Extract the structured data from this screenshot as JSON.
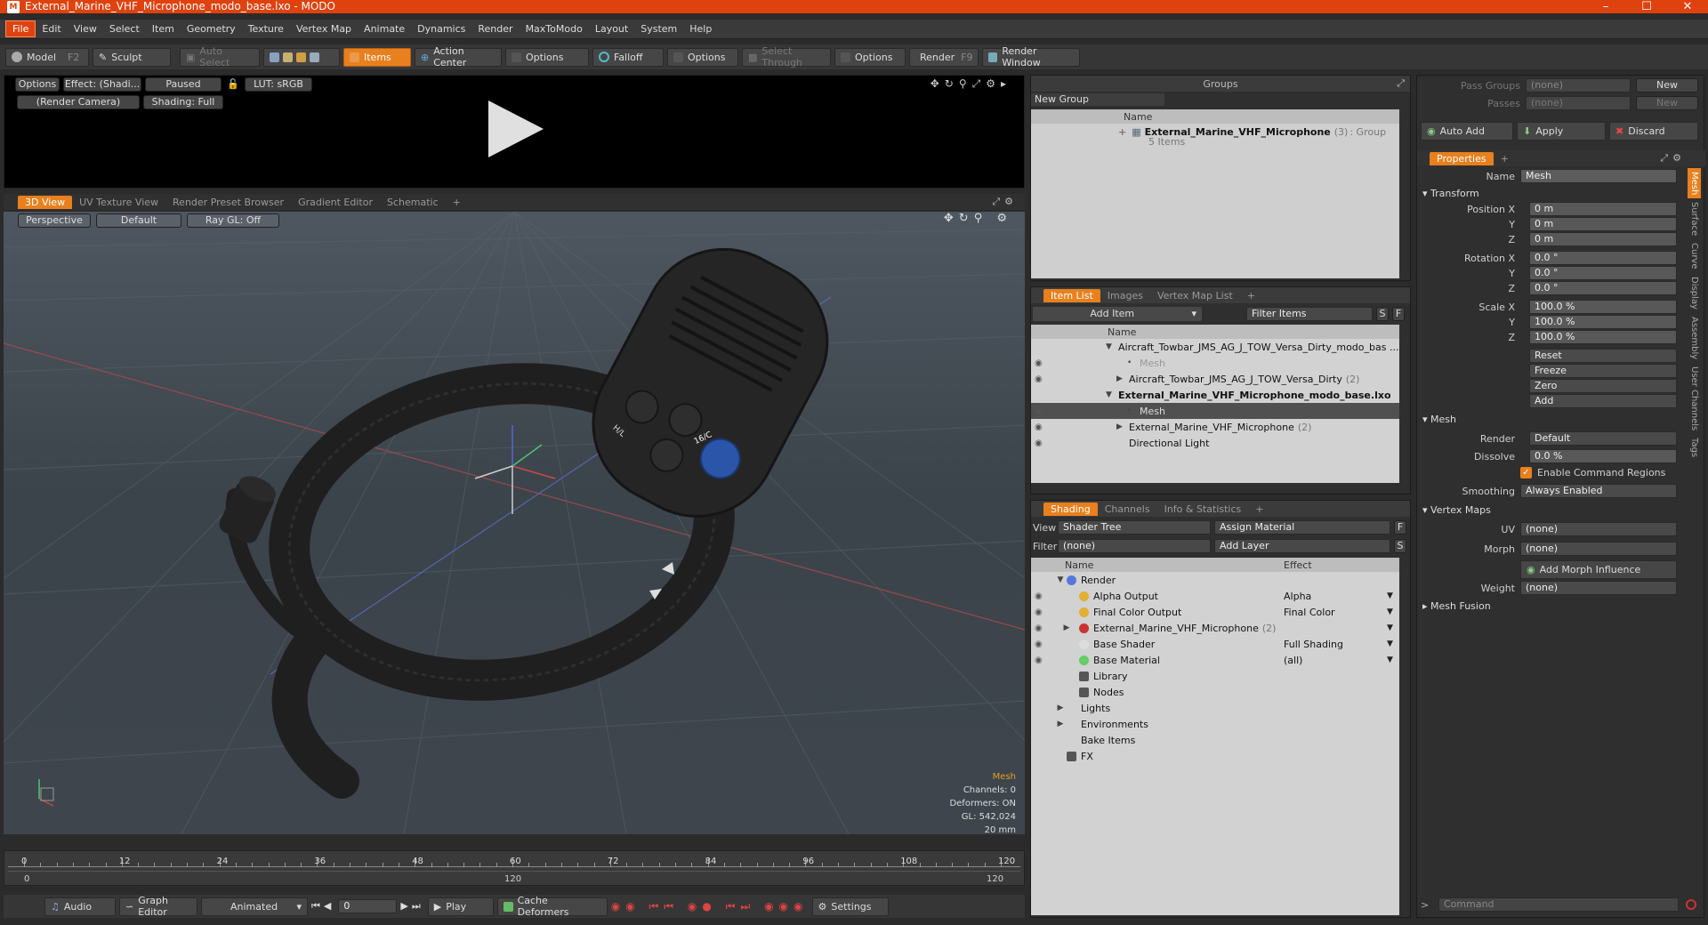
{
  "title": "External_Marine_VHF_Microphone_modo_base.lxo - MODO",
  "logo": "M",
  "menu": [
    "File",
    "Edit",
    "View",
    "Select",
    "Item",
    "Geometry",
    "Texture",
    "Vertex Map",
    "Animate",
    "Dynamics",
    "Render",
    "MaxToModo",
    "Layout",
    "System",
    "Help"
  ],
  "toolbar": {
    "model": "Model",
    "model_key": "F2",
    "sculpt": "Sculpt",
    "auto_select": "Auto Select",
    "items": "Items",
    "action_center": "Action Center",
    "options1": "Options",
    "falloff": "Falloff",
    "options2": "Options",
    "select_through": "Select Through",
    "options3": "Options",
    "render": "Render",
    "render_key": "F9",
    "render_window": "Render Window"
  },
  "preview": {
    "options": "Options",
    "effect": "Effect: (Shadi...",
    "paused": "Paused",
    "lut": "LUT: sRGB",
    "camera": "(Render Camera)",
    "shading": "Shading: Full"
  },
  "viewtabs": [
    "3D View",
    "UV Texture View",
    "Render Preset Browser",
    "Gradient Editor",
    "Schematic"
  ],
  "viewport": {
    "projection": "Perspective",
    "style": "Default",
    "raygl": "Ray GL: Off"
  },
  "stats": {
    "type": "Mesh",
    "channels": "Channels: 0",
    "deformers": "Deformers: ON",
    "gl": "GL: 542,024",
    "units": "20 mm"
  },
  "mic_labels": {
    "hl": "H/L",
    "ch": "16/C"
  },
  "timeline": {
    "ticks": [
      "0",
      "12",
      "24",
      "36",
      "48",
      "60",
      "72",
      "84",
      "96",
      "108",
      "120"
    ],
    "start": "0",
    "mid": "120",
    "end": "120"
  },
  "bottom": {
    "audio": "Audio",
    "graph_editor": "Graph Editor",
    "animated": "Animated",
    "frame": "0",
    "play": "Play",
    "cache": "Cache Deformers",
    "settings": "Settings"
  },
  "groups": {
    "title": "Groups",
    "new_group": "New Group",
    "col_name": "Name",
    "item_name": "External_Marine_VHF_Microphone",
    "item_count": "(3)",
    "item_type": ": Group",
    "item_sub": "5 Items"
  },
  "itemlist": {
    "tabs": [
      "Item List",
      "Images",
      "Vertex Map List"
    ],
    "add_item": "Add Item",
    "filter": "Filter Items",
    "s": "S",
    "f": "F",
    "col_name": "Name",
    "rows": [
      {
        "label": "Aircraft_Towbar_JMS_AG_J_TOW_Versa_Dirty_modo_bas ...",
        "indent": 0,
        "bold": false
      },
      {
        "label": "Mesh",
        "indent": 2,
        "bold": false,
        "dim": true
      },
      {
        "label": "Aircraft_Towbar_JMS_AG_J_TOW_Versa_Dirty",
        "count": "(2)",
        "indent": 1,
        "bold": false
      },
      {
        "label": "External_Marine_VHF_Microphone_modo_base.lxo",
        "indent": 0,
        "bold": true
      },
      {
        "label": "Mesh",
        "indent": 2,
        "bold": false,
        "dim": true,
        "sel": true
      },
      {
        "label": "External_Marine_VHF_Microphone",
        "count": "(2)",
        "indent": 1,
        "bold": false
      },
      {
        "label": "Directional Light",
        "indent": 1,
        "bold": false
      }
    ]
  },
  "shading": {
    "tabs": [
      "Shading",
      "Channels",
      "Info & Statistics"
    ],
    "view_label": "View",
    "view_value": "Shader Tree",
    "assign": "Assign Material",
    "filter_label": "Filter",
    "filter_value": "(none)",
    "add_layer": "Add Layer",
    "f": "F",
    "s": "S",
    "col_name": "Name",
    "col_effect": "Effect",
    "rows": [
      {
        "label": "Render",
        "effect": "",
        "indent": 0
      },
      {
        "label": "Alpha Output",
        "effect": "Alpha",
        "indent": 1
      },
      {
        "label": "Final Color Output",
        "effect": "Final Color",
        "indent": 1
      },
      {
        "label": "External_Marine_VHF_Microphone",
        "count": "(2)",
        "effect": "",
        "indent": 1
      },
      {
        "label": "Base Shader",
        "effect": "Full Shading",
        "indent": 1
      },
      {
        "label": "Base Material",
        "effect": "(all)",
        "indent": 1
      },
      {
        "label": "Library",
        "effect": "",
        "indent": 1
      },
      {
        "label": "Nodes",
        "effect": "",
        "indent": 1
      },
      {
        "label": "Lights",
        "effect": "",
        "indent": 0
      },
      {
        "label": "Environments",
        "effect": "",
        "indent": 0
      },
      {
        "label": "Bake Items",
        "effect": "",
        "indent": 0
      },
      {
        "label": "FX",
        "effect": "",
        "indent": 0
      }
    ]
  },
  "props": {
    "pass_groups": "Pass Groups",
    "passes": "Passes",
    "none": "(none)",
    "new": "New",
    "auto_add": "Auto Add",
    "apply": "Apply",
    "discard": "Discard",
    "tab": "Properties",
    "name_label": "Name",
    "name_value": "Mesh",
    "transform": "Transform",
    "pos_label": "Position X",
    "rot_label": "Rotation X",
    "scale_label": "Scale X",
    "y": "Y",
    "z": "Z",
    "pos": [
      "0 m",
      "0 m",
      "0 m"
    ],
    "rot": [
      "0.0 °",
      "0.0 °",
      "0.0 °"
    ],
    "scale": [
      "100.0 %",
      "100.0 %",
      "100.0 %"
    ],
    "reset": "Reset",
    "freeze": "Freeze",
    "zero": "Zero",
    "add": "Add",
    "mesh": "Mesh",
    "render_label": "Render",
    "render_value": "Default",
    "dissolve_label": "Dissolve",
    "dissolve_value": "0.0 %",
    "enable_cmd": "Enable Command Regions",
    "smoothing_label": "Smoothing",
    "smoothing_value": "Always Enabled",
    "vertex_maps": "Vertex Maps",
    "uv_label": "UV",
    "uv_value": "(none)",
    "morph_label": "Morph",
    "morph_value": "(none)",
    "add_morph": "Add Morph Influence",
    "weight_label": "Weight",
    "weight_value": "(none)",
    "mesh_fusion": "Mesh Fusion",
    "side_tabs": [
      "Mesh",
      "Surface",
      "Curve",
      "Display",
      "Assembly",
      "User Channels",
      "Tags"
    ],
    "command": "Command"
  }
}
